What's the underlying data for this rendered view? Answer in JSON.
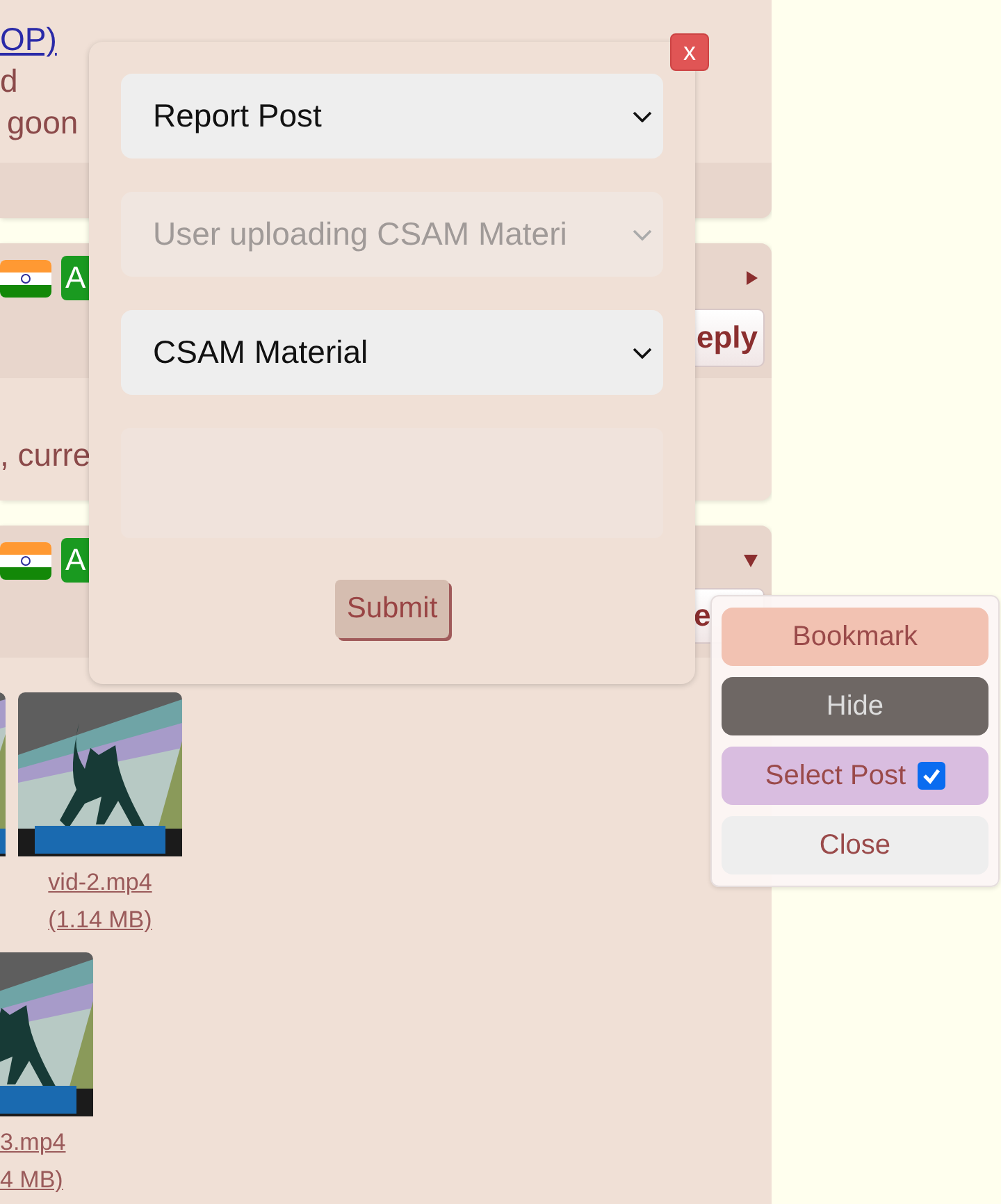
{
  "posts": [
    {
      "lines": [
        {
          "kind": "link",
          "text": "OP)"
        },
        {
          "kind": "text",
          "text": "d"
        },
        {
          "kind": "text",
          "text": "goon"
        }
      ]
    },
    {
      "badge": "A",
      "reply_label": "eply",
      "expanded": false,
      "lines": [
        {
          "kind": "text",
          "text": ", curre"
        }
      ]
    },
    {
      "badge": "A",
      "reply_label": "e",
      "expanded": true,
      "files": [
        {
          "name": "vid-2.mp4",
          "size": "(1.14 MB)"
        },
        {
          "name": "3.mp4",
          "size": "4 MB)"
        }
      ]
    }
  ],
  "report_dialog": {
    "close_label": "x",
    "fields": [
      {
        "kind": "select",
        "value": "Report Post",
        "disabled": false
      },
      {
        "kind": "select",
        "value": "User uploading CSAM Materi",
        "disabled": true
      },
      {
        "kind": "select",
        "value": "CSAM Material",
        "disabled": false
      },
      {
        "kind": "textarea"
      }
    ],
    "submit_label": "Submit"
  },
  "post_menu": {
    "items": [
      {
        "kind": "bookmark",
        "label": "Bookmark"
      },
      {
        "kind": "hide",
        "label": "Hide"
      },
      {
        "kind": "select",
        "label": "Select Post",
        "checked": true
      },
      {
        "kind": "close",
        "label": "Close"
      }
    ]
  }
}
